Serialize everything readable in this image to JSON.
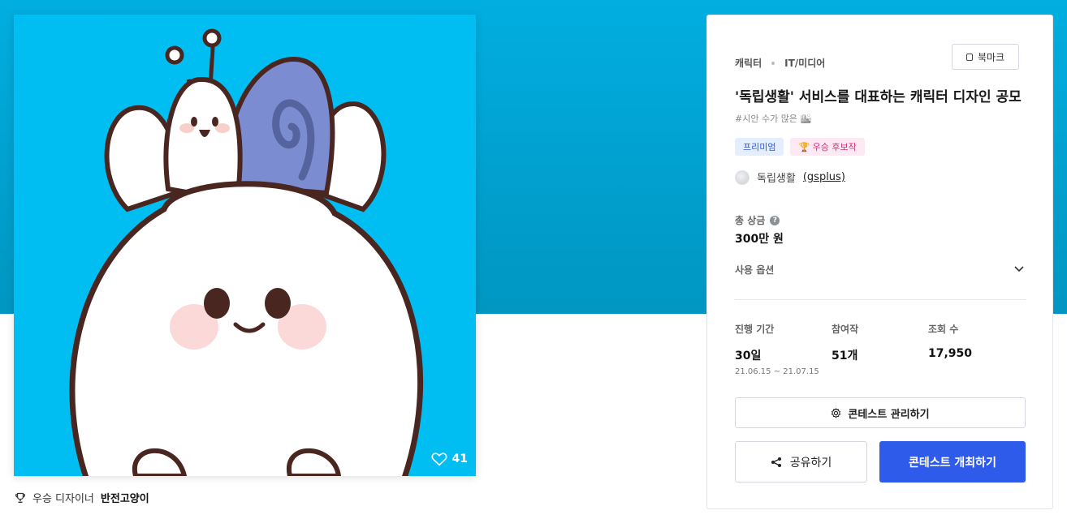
{
  "colors": {
    "banner": "#01aee0",
    "artwork_bg": "#00bdf2",
    "primary": "#2f5bea",
    "winner_pink": "#d0307c"
  },
  "artwork": {
    "like_count": "41",
    "like_icon": "heart-outline-icon"
  },
  "winner": {
    "icon": "trophy-icon",
    "label": "우승 디자이너",
    "name": "반전고양이"
  },
  "contest": {
    "bookmark_label": "북마크",
    "category": "캐릭터",
    "subcategory": "IT/미디어",
    "title": "'독립생활' 서비스를 대표하는 캐릭터 디자인 공모",
    "hashtag": "#시안 수가 많은 🏙",
    "badges": {
      "premium": "프리미엄",
      "winner": "🏆 우승 후보작"
    },
    "host_name": "독립생활",
    "host_id": "(gsplus)",
    "prize_label": "총 상금",
    "prize_value": "300만 원",
    "options_label": "사용 옵션",
    "stats": {
      "period_label": "진행 기간",
      "period_value": "30일",
      "period_dates": "21.06.15 ~ 21.07.15",
      "entries_label": "참여작",
      "entries_value": "51개",
      "views_label": "조회 수",
      "views_value": "17,950"
    },
    "manage_label": "콘테스트 관리하기",
    "share_label": "공유하기",
    "host_contest_label": "콘테스트 개최하기"
  }
}
